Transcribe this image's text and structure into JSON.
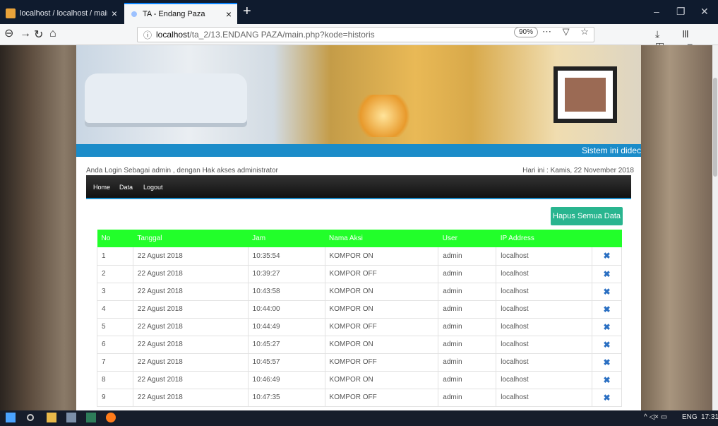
{
  "browser": {
    "tabs": [
      {
        "title": "localhost / localhost / maindb"
      },
      {
        "title": "TA - Endang Paza"
      }
    ],
    "url_host": "localhost",
    "url_path": "/ta_2/13.ENDANG PAZA/main.php?kode=historis",
    "zoom": "90%"
  },
  "header": {
    "marquee": "Sistem ini didec"
  },
  "session": {
    "login_info": "Anda Login Sebagai admin , dengan Hak akses administrator",
    "date_info": "Hari ini : Kamis, 22 November 2018"
  },
  "menu": {
    "items": [
      "Home",
      "Data",
      "Logout"
    ]
  },
  "actions": {
    "delete_all": "Hapus Semua Data"
  },
  "table": {
    "columns": [
      "No",
      "Tanggal",
      "Jam",
      "Nama Aksi",
      "User",
      "IP Address",
      ""
    ],
    "rows": [
      [
        "1",
        "22 Agust 2018",
        "10:35:54",
        "KOMPOR ON",
        "admin",
        "localhost"
      ],
      [
        "2",
        "22 Agust 2018",
        "10:39:27",
        "KOMPOR OFF",
        "admin",
        "localhost"
      ],
      [
        "3",
        "22 Agust 2018",
        "10:43:58",
        "KOMPOR ON",
        "admin",
        "localhost"
      ],
      [
        "4",
        "22 Agust 2018",
        "10:44:00",
        "KOMPOR ON",
        "admin",
        "localhost"
      ],
      [
        "5",
        "22 Agust 2018",
        "10:44:49",
        "KOMPOR OFF",
        "admin",
        "localhost"
      ],
      [
        "6",
        "22 Agust 2018",
        "10:45:27",
        "KOMPOR ON",
        "admin",
        "localhost"
      ],
      [
        "7",
        "22 Agust 2018",
        "10:45:57",
        "KOMPOR OFF",
        "admin",
        "localhost"
      ],
      [
        "8",
        "22 Agust 2018",
        "10:46:49",
        "KOMPOR ON",
        "admin",
        "localhost"
      ],
      [
        "9",
        "22 Agust 2018",
        "10:47:35",
        "KOMPOR OFF",
        "admin",
        "localhost"
      ]
    ],
    "delete_icon": "✖",
    "header_color": "#22ff2a"
  },
  "taskbar": {
    "tray_lang": "ENG",
    "tray_time": "17:31"
  }
}
